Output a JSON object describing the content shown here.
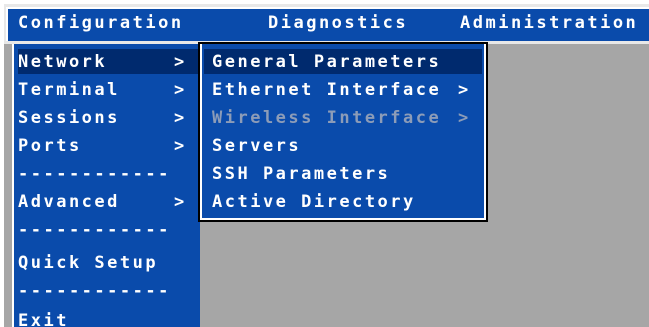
{
  "menubar": {
    "items": [
      {
        "label": "Configuration",
        "active": true
      },
      {
        "label": "Diagnostics",
        "active": false
      },
      {
        "label": "Administration",
        "active": false
      }
    ]
  },
  "left_menu": {
    "items": [
      {
        "label": "Network",
        "arrow": ">",
        "selected": true
      },
      {
        "label": "Terminal",
        "arrow": ">"
      },
      {
        "label": "Sessions",
        "arrow": ">"
      },
      {
        "label": "Ports",
        "arrow": ">"
      },
      {
        "label": "------------"
      },
      {
        "label": "Advanced",
        "arrow": ">"
      },
      {
        "label": "------------"
      },
      {
        "label": "Quick Setup"
      },
      {
        "label": "------------"
      },
      {
        "label": "Exit"
      }
    ]
  },
  "sub_menu": {
    "items": [
      {
        "label": "General Parameters",
        "selected": true
      },
      {
        "label": "Ethernet Interface",
        "arrow": ">"
      },
      {
        "label": "Wireless Interface",
        "arrow": ">",
        "disabled": true
      },
      {
        "label": "Servers"
      },
      {
        "label": "SSH Parameters"
      },
      {
        "label": "Active Directory"
      }
    ]
  },
  "colors": {
    "menu_blue": "#0a4bab",
    "selected_blue": "#002a6e",
    "background_gray": "#a6a6a6",
    "disabled_text": "#8c9cb8"
  }
}
